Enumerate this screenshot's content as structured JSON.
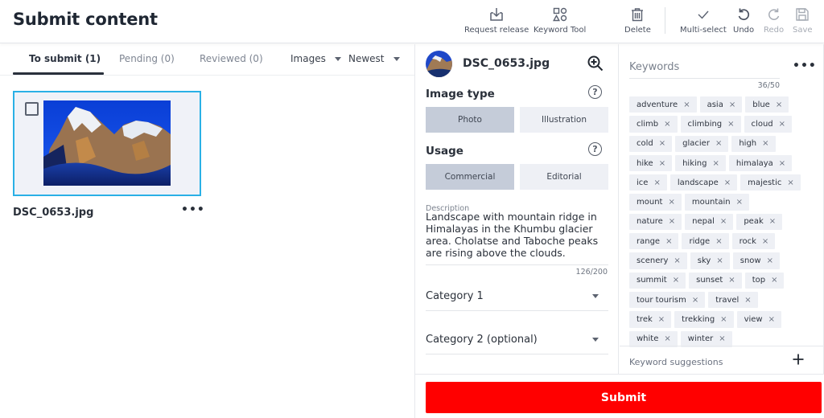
{
  "header": {
    "title": "Submit content",
    "toolbar": [
      {
        "id": "request-release",
        "label": "Request release",
        "icon": "download-tray-icon",
        "enabled": true
      },
      {
        "id": "keyword-tool",
        "label": "Keyword Tool",
        "icon": "shapes-icon",
        "enabled": true
      },
      {
        "id": "delete",
        "label": "Delete",
        "icon": "trash-icon",
        "enabled": true
      },
      {
        "id": "multi-select",
        "label": "Multi-select",
        "icon": "checkmark-icon",
        "enabled": true
      },
      {
        "id": "undo",
        "label": "Undo",
        "icon": "undo-icon",
        "enabled": true
      },
      {
        "id": "redo",
        "label": "Redo",
        "icon": "redo-icon",
        "enabled": false
      },
      {
        "id": "save",
        "label": "Save",
        "icon": "floppy-disk-icon",
        "enabled": false
      }
    ]
  },
  "left": {
    "tabs": [
      {
        "label": "To submit (1)",
        "active": true
      },
      {
        "label": "Pending (0)",
        "active": false
      },
      {
        "label": "Reviewed (0)",
        "active": false
      }
    ],
    "filters": {
      "type": "Images",
      "sort": "Newest"
    },
    "assets": [
      {
        "name": "DSC_0653.jpg",
        "selected": false,
        "more": "•••"
      }
    ]
  },
  "details": {
    "filename": "DSC_0653.jpg",
    "image_type": {
      "title": "Image type",
      "options": [
        "Photo",
        "Illustration"
      ],
      "selected": "Photo"
    },
    "usage": {
      "title": "Usage",
      "options": [
        "Commercial",
        "Editorial"
      ],
      "selected": "Commercial"
    },
    "description": {
      "label": "Description",
      "value": "Landscape with mountain ridge in Himalayas in the Khumbu glacier area. Cholatse and Taboche peaks are rising above the clouds.",
      "count": "126/200"
    },
    "category1": {
      "label": "Category 1"
    },
    "category2": {
      "label": "Category 2 (optional)"
    },
    "help_glyph": "?"
  },
  "keywords": {
    "placeholder": "Keywords",
    "more": "•••",
    "count": "36/50",
    "items": [
      "adventure",
      "asia",
      "blue",
      "climb",
      "climbing",
      "cloud",
      "cold",
      "glacier",
      "high",
      "hike",
      "hiking",
      "himalaya",
      "ice",
      "landscape",
      "majestic",
      "mount",
      "mountain",
      "nature",
      "nepal",
      "peak",
      "range",
      "ridge",
      "rock",
      "scenery",
      "sky",
      "snow",
      "summit",
      "sunset",
      "top",
      "tour tourism",
      "travel",
      "trek",
      "trekking",
      "view",
      "white",
      "winter"
    ],
    "remove_glyph": "×",
    "suggestions_label": "Keyword suggestions"
  },
  "footer": {
    "submit_label": "Submit",
    "submit_color": "#ff0000"
  }
}
